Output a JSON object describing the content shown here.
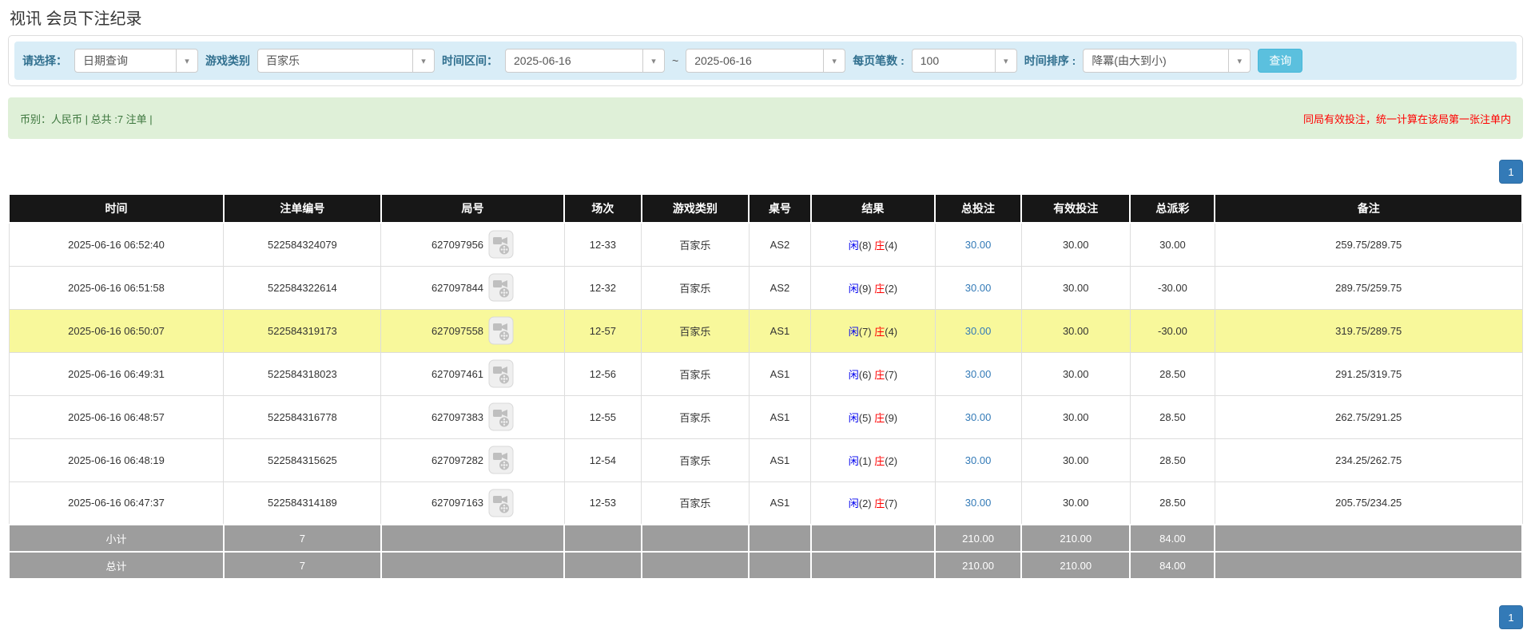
{
  "page": {
    "title": "视讯 会员下注纪录"
  },
  "filters": {
    "select_label": "请选择：",
    "select_value": "日期查询",
    "game_type_label": "游戏类别",
    "game_type_value": "百家乐",
    "time_range_label": "时间区间：",
    "date_from": "2025-06-16",
    "tilde": "~",
    "date_to": "2025-06-16",
    "page_size_label": "每页笔数 :",
    "page_size_value": "100",
    "sort_label": "时间排序 :",
    "sort_value": "降冪(由大到小)",
    "search_button": "查询"
  },
  "summary": {
    "left_text": "币别：人民币 | 总共 :7 注单 |",
    "right_text": "同局有效投注，统一计算在该局第一张注单内"
  },
  "pagination": {
    "page": "1"
  },
  "table": {
    "headers": [
      "时间",
      "注单编号",
      "局号",
      "场次",
      "游戏类别",
      "桌号",
      "结果",
      "总投注",
      "有效投注",
      "总派彩",
      "备注"
    ],
    "rows": [
      {
        "time": "2025-06-16 06:52:40",
        "bet_no": "522584324079",
        "round_no": "627097956",
        "session": "12-33",
        "game": "百家乐",
        "table_no": "AS2",
        "player": "闲",
        "player_num": "(8)",
        "banker": "庄",
        "banker_num": "(4)",
        "total_bet": "30.00",
        "valid_bet": "30.00",
        "payout": "30.00",
        "remark": "259.75/289.75",
        "highlighted": false
      },
      {
        "time": "2025-06-16 06:51:58",
        "bet_no": "522584322614",
        "round_no": "627097844",
        "session": "12-32",
        "game": "百家乐",
        "table_no": "AS2",
        "player": "闲",
        "player_num": "(9)",
        "banker": "庄",
        "banker_num": "(2)",
        "total_bet": "30.00",
        "valid_bet": "30.00",
        "payout": "-30.00",
        "remark": "289.75/259.75",
        "highlighted": false
      },
      {
        "time": "2025-06-16 06:50:07",
        "bet_no": "522584319173",
        "round_no": "627097558",
        "session": "12-57",
        "game": "百家乐",
        "table_no": "AS1",
        "player": "闲",
        "player_num": "(7)",
        "banker": "庄",
        "banker_num": "(4)",
        "total_bet": "30.00",
        "valid_bet": "30.00",
        "payout": "-30.00",
        "remark": "319.75/289.75",
        "highlighted": true
      },
      {
        "time": "2025-06-16 06:49:31",
        "bet_no": "522584318023",
        "round_no": "627097461",
        "session": "12-56",
        "game": "百家乐",
        "table_no": "AS1",
        "player": "闲",
        "player_num": "(6)",
        "banker": "庄",
        "banker_num": "(7)",
        "total_bet": "30.00",
        "valid_bet": "30.00",
        "payout": "28.50",
        "remark": "291.25/319.75",
        "highlighted": false
      },
      {
        "time": "2025-06-16 06:48:57",
        "bet_no": "522584316778",
        "round_no": "627097383",
        "session": "12-55",
        "game": "百家乐",
        "table_no": "AS1",
        "player": "闲",
        "player_num": "(5)",
        "banker": "庄",
        "banker_num": "(9)",
        "total_bet": "30.00",
        "valid_bet": "30.00",
        "payout": "28.50",
        "remark": "262.75/291.25",
        "highlighted": false
      },
      {
        "time": "2025-06-16 06:48:19",
        "bet_no": "522584315625",
        "round_no": "627097282",
        "session": "12-54",
        "game": "百家乐",
        "table_no": "AS1",
        "player": "闲",
        "player_num": "(1)",
        "banker": "庄",
        "banker_num": "(2)",
        "total_bet": "30.00",
        "valid_bet": "30.00",
        "payout": "28.50",
        "remark": "234.25/262.75",
        "highlighted": false
      },
      {
        "time": "2025-06-16 06:47:37",
        "bet_no": "522584314189",
        "round_no": "627097163",
        "session": "12-53",
        "game": "百家乐",
        "table_no": "AS1",
        "player": "闲",
        "player_num": "(2)",
        "banker": "庄",
        "banker_num": "(7)",
        "total_bet": "30.00",
        "valid_bet": "30.00",
        "payout": "28.50",
        "remark": "205.75/234.25",
        "highlighted": false
      }
    ],
    "subtotal": {
      "label": "小计",
      "count": "7",
      "total_bet": "210.00",
      "valid_bet": "210.00",
      "payout": "84.00"
    },
    "total": {
      "label": "总计",
      "count": "7",
      "total_bet": "210.00",
      "valid_bet": "210.00",
      "payout": "84.00"
    }
  },
  "colors": {
    "accent_blue": "#337ab7",
    "search_button": "#5bc0de",
    "filter_bg": "#d9edf7",
    "summary_bg": "#dff0d8",
    "summary_text": "#3c763d",
    "alert_red": "#ff0000",
    "table_header_bg": "#171717",
    "table_footer_bg": "#9d9d9d",
    "highlight_row": "#f8f89b",
    "player_blue": "#0000ee",
    "banker_red": "#ff0000",
    "link_blue": "#337ab7"
  }
}
